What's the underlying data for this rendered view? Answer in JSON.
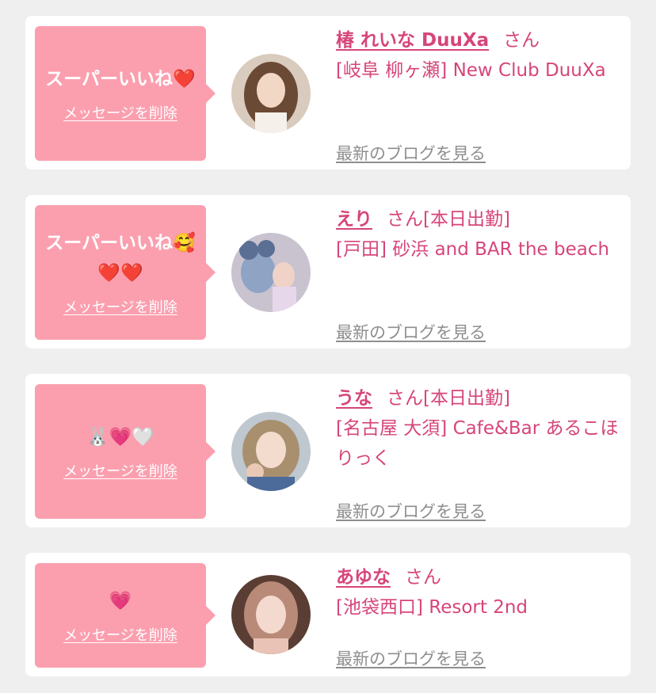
{
  "messages": [
    {
      "text": "スーパーいいね❤️",
      "delete_label": "メッセージを削除",
      "name": "椿 れいな DuuXa",
      "suffix": "さん",
      "shop": "[岐阜 柳ヶ瀬] New Club DuuXa",
      "blog_label": "最新のブログを見る",
      "avatar_icon": "avatar-photo"
    },
    {
      "text": "スーパーいいね🥰\n❤️❤️",
      "delete_label": "メッセージを削除",
      "name": "えり",
      "suffix": "さん[本日出勤]",
      "shop": "[戸田] 砂浜 and BAR the beach",
      "blog_label": "最新のブログを見る",
      "avatar_icon": "avatar-photo"
    },
    {
      "text": "🐰💗🤍",
      "delete_label": "メッセージを削除",
      "name": "うな",
      "suffix": "さん[本日出勤]",
      "shop": "[名古屋 大須] Cafe&Bar あるこほりっく",
      "blog_label": "最新のブログを見る",
      "avatar_icon": "avatar-photo"
    },
    {
      "text": "💗",
      "delete_label": "メッセージを削除",
      "name": "あゆな",
      "suffix": "さん",
      "shop": "[池袋西口] Resort 2nd",
      "blog_label": "最新のブログを見る",
      "avatar_icon": "avatar-photo"
    }
  ],
  "colors": {
    "bubble": "#fb9faf",
    "accent": "#d6457a",
    "link_gray": "#8e8e8e",
    "background": "#efefef"
  }
}
